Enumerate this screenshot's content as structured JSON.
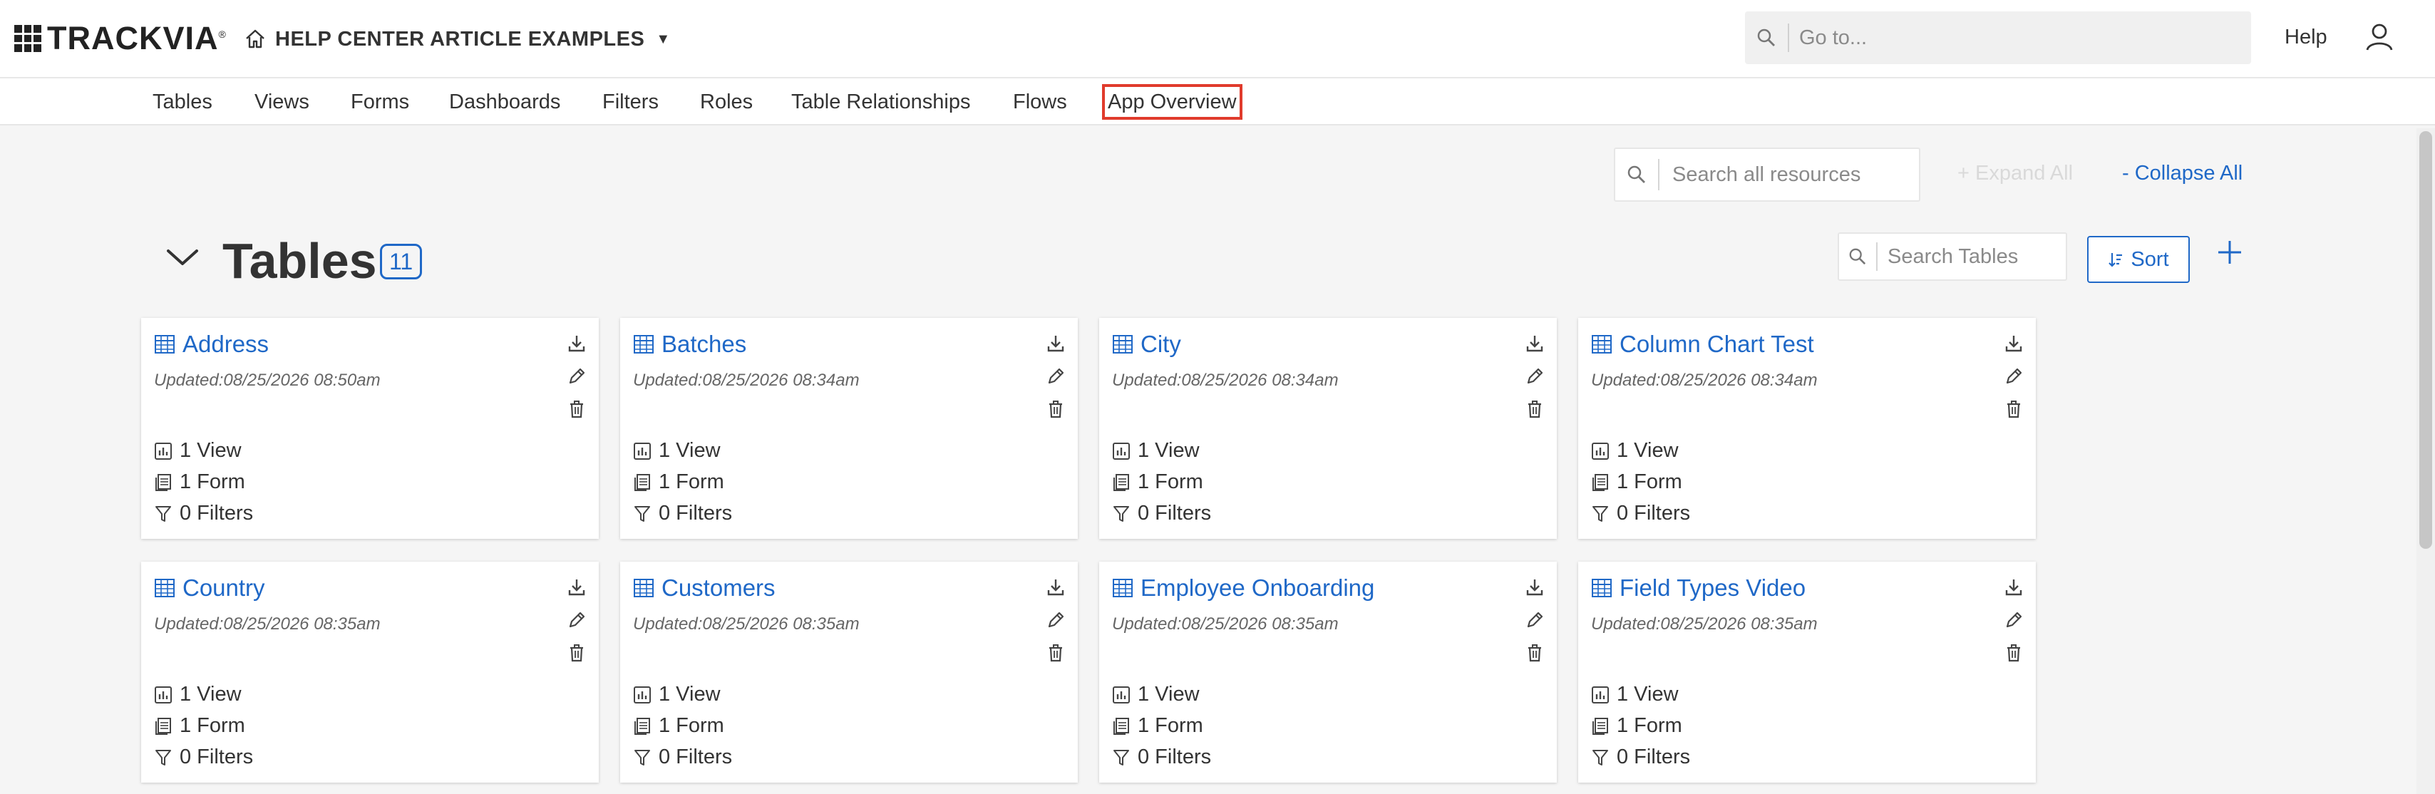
{
  "brand": {
    "logo_text": "TRACKVIA",
    "trademark": "®"
  },
  "app_switcher": {
    "name": "HELP CENTER ARTICLE EXAMPLES",
    "icon": "home-icon",
    "caret": "▼"
  },
  "global_search": {
    "placeholder": "Go to...",
    "value": ""
  },
  "header": {
    "help_label": "Help",
    "user_icon": "user-icon"
  },
  "nav": {
    "tabs": [
      {
        "label": "Tables"
      },
      {
        "label": "Views"
      },
      {
        "label": "Forms"
      },
      {
        "label": "Dashboards"
      },
      {
        "label": "Filters"
      },
      {
        "label": "Roles"
      },
      {
        "label": "Table Relationships"
      },
      {
        "label": "Flows"
      },
      {
        "label": "App Overview",
        "active": true
      }
    ]
  },
  "toolbar": {
    "search_placeholder": "Search all resources",
    "expand_all": "+ Expand All",
    "collapse_all": "- Collapse All"
  },
  "section": {
    "title": "Tables",
    "count": "11",
    "search_placeholder": "Search Tables",
    "sort_label": "Sort"
  },
  "cards": [
    {
      "title": "Address",
      "updated": "Updated:08/25/2026 08:50am",
      "views": "1 View",
      "forms": "1 Form",
      "filters": "0 Filters"
    },
    {
      "title": "Batches",
      "updated": "Updated:08/25/2026 08:34am",
      "views": "1 View",
      "forms": "1 Form",
      "filters": "0 Filters"
    },
    {
      "title": "City",
      "updated": "Updated:08/25/2026 08:34am",
      "views": "1 View",
      "forms": "1 Form",
      "filters": "0 Filters"
    },
    {
      "title": "Column Chart Test",
      "updated": "Updated:08/25/2026 08:34am",
      "views": "1 View",
      "forms": "1 Form",
      "filters": "0 Filters"
    },
    {
      "title": "Country",
      "updated": "Updated:08/25/2026 08:35am",
      "views": "1 View",
      "forms": "1 Form",
      "filters": "0 Filters"
    },
    {
      "title": "Customers",
      "updated": "Updated:08/25/2026 08:35am",
      "views": "1 View",
      "forms": "1 Form",
      "filters": "0 Filters"
    },
    {
      "title": "Employee Onboarding",
      "updated": "Updated:08/25/2026 08:35am",
      "views": "1 View",
      "forms": "1 Form",
      "filters": "0 Filters"
    },
    {
      "title": "Field Types Video",
      "updated": "Updated:08/25/2026 08:35am",
      "views": "1 View",
      "forms": "1 Form",
      "filters": "0 Filters"
    }
  ],
  "colors": {
    "accent": "#1f68c7",
    "highlight": "#e03b2c",
    "background": "#f5f5f5"
  }
}
